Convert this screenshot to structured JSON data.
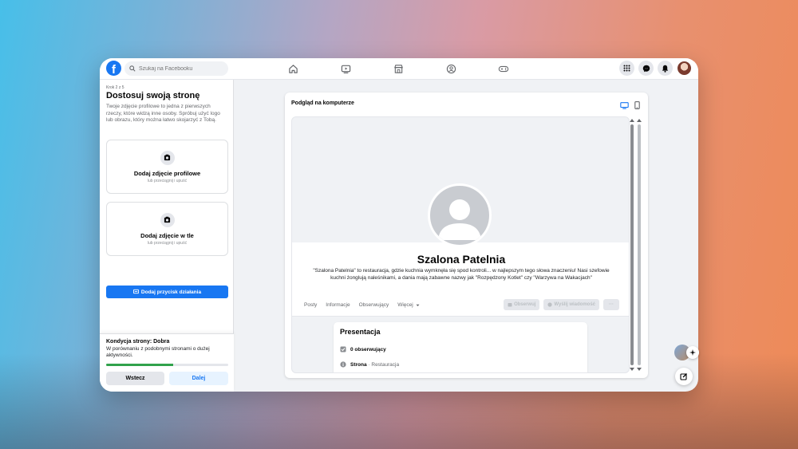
{
  "topbar": {
    "logo": "f",
    "search_placeholder": "Szukaj na Facebooku",
    "nav_icons": [
      "home-icon",
      "video-icon",
      "marketplace-icon",
      "groups-icon",
      "gaming-icon"
    ],
    "right_icons": [
      "menu-grid-icon",
      "messenger-icon",
      "bell-icon"
    ]
  },
  "left": {
    "step": "Krok 2 z 5",
    "title": "Dostosuj swoją stronę",
    "description": "Twoje zdjęcie profilowe to jedna z pierwszych rzeczy, które widzą inne osoby. Spróbuj użyć logo lub obrazu, który można łatwo skojarzyć z Tobą.",
    "profile_photo": {
      "title": "Dodaj zdjęcie profilowe",
      "subtitle": "lub przeciągnij i upuść"
    },
    "cover_photo": {
      "title": "Dodaj zdjęcie w tle",
      "subtitle": "lub przeciągnij i upuść"
    },
    "cta_label": "Dodaj przycisk działania",
    "footer": {
      "condition_title": "Kondycja strony: Dobra",
      "condition_desc": "W porównaniu z podobnymi stronami o dużej aktywności.",
      "progress_fraction": 0.55,
      "progress_color": "#31a24c",
      "back_label": "Wstecz",
      "next_label": "Dalej"
    }
  },
  "preview": {
    "title": "Podgląd na komputerze",
    "page": {
      "name": "Szalona Patelnia",
      "description": "\"Szalona Patelnia\" to restauracja, gdzie kuchnia wymknęła się spod kontroli... w najlepszym tego słowa znaczeniu! Nasi szefowie kuchni żonglują naleśnikami, a dania mają zabawne nazwy jak \"Rozpędzony Kotlet\" czy \"Warzywa na Wakacjach\"",
      "tabs": [
        "Posty",
        "Informacje",
        "Obserwujący",
        "Więcej"
      ],
      "follow_label": "Obserwuj",
      "message_label": "Wyślij wiadomość",
      "more_label": "···",
      "about": {
        "title": "Presentacja",
        "followers": "0 obserwujący",
        "category_label": "Strona",
        "category_value": "· Restauracja"
      }
    }
  },
  "colors": {
    "brand": "#1877f2"
  }
}
